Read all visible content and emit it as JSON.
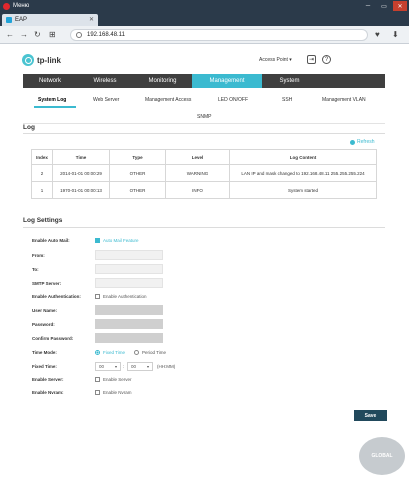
{
  "browser": {
    "menu_label": "Меню",
    "tab_title": "EAP",
    "url": "192.168.48.11",
    "new_tab": "+",
    "win_min": "─",
    "win_max": "▭",
    "win_close": "✕"
  },
  "header": {
    "brand": "tp-link",
    "mode": "Access Point",
    "mode_arrow": "▾"
  },
  "main_nav": [
    {
      "label": "Network",
      "active": false
    },
    {
      "label": "Wireless",
      "active": false
    },
    {
      "label": "Monitoring",
      "active": false
    },
    {
      "label": "Management",
      "active": true
    },
    {
      "label": "System",
      "active": false
    }
  ],
  "sub_nav": [
    {
      "label": "System Log",
      "active": true
    },
    {
      "label": "Web Server"
    },
    {
      "label": "Management Access"
    },
    {
      "label": "LED ON/OFF"
    },
    {
      "label": "SSH"
    },
    {
      "label": "Management VLAN"
    },
    {
      "label": "SNMP"
    }
  ],
  "log": {
    "title": "Log",
    "refresh": "Refresh",
    "columns": [
      "Index",
      "Time",
      "Type",
      "Level",
      "Log Content"
    ],
    "rows": [
      [
        "2",
        "2014-01-01 00:00:29",
        "OTHER",
        "WARNING",
        "LAN IP and mask changed to 192.168.48.11 255.255.255.224"
      ],
      [
        "1",
        "1970-01-01 00:00:13",
        "OTHER",
        "INFO",
        "System started"
      ]
    ]
  },
  "settings": {
    "title": "Log Settings",
    "enable_auto_mail_label": "Enable Auto Mail:",
    "auto_mail_feature": "Auto Mail Feature",
    "from_label": "From:",
    "to_label": "To:",
    "smtp_label": "SMTP Server:",
    "enable_auth_label": "Enable Authentication:",
    "enable_auth_option": "Enable Authentication",
    "username_label": "User Name:",
    "password_label": "Password:",
    "confirm_password_label": "Confirm Password:",
    "time_mode_label": "Time Mode:",
    "fixed_time_option": "Fixed Time",
    "period_time_option": "Period Time",
    "fixed_time_label": "Fixed Time:",
    "hour_value": "00",
    "minute_value": "00",
    "time_sep": ":",
    "time_format": "(HH:MM)",
    "enable_server_label": "Enable Server:",
    "enable_server_option": "Enable Server",
    "enable_nvram_label": "Enable Nvram:",
    "enable_nvram_option": "Enable Nvram",
    "save": "Save"
  },
  "watermark": "GLOBAL",
  "accent_color": "#3bbad0",
  "nav_color": "#3f3f3f"
}
